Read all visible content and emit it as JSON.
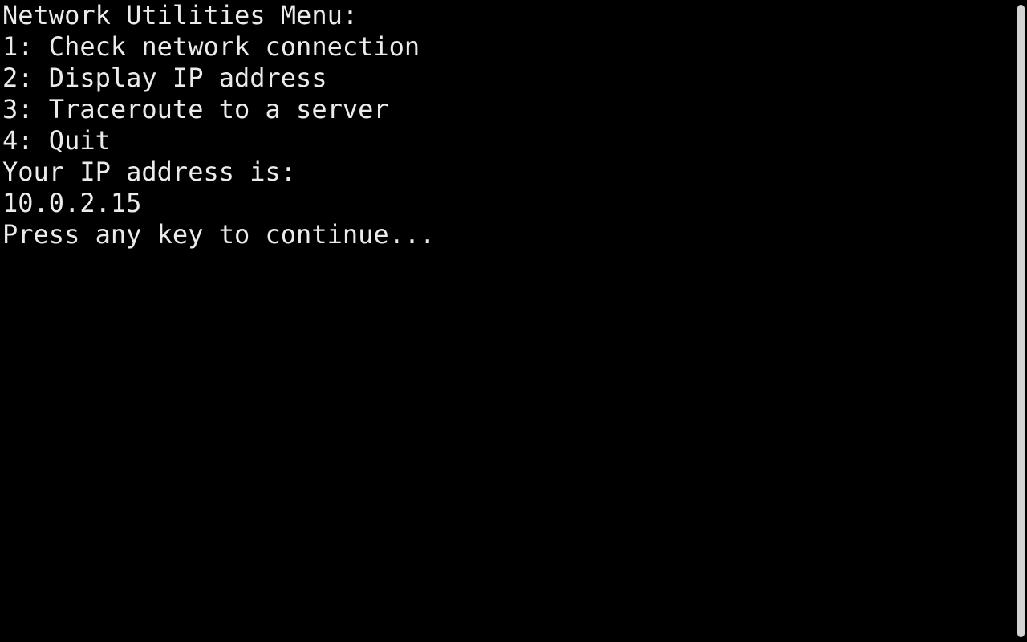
{
  "terminal": {
    "lines": [
      "Network Utilities Menu:",
      "1: Check network connection",
      "2: Display IP address",
      "3: Traceroute to a server",
      "4: Quit",
      "Your IP address is:",
      "10.0.2.15",
      "Press any key to continue..."
    ],
    "colors": {
      "background": "#000000",
      "text": "#ebebeb",
      "scrollbar_thumb": "#d4d4d4"
    }
  }
}
